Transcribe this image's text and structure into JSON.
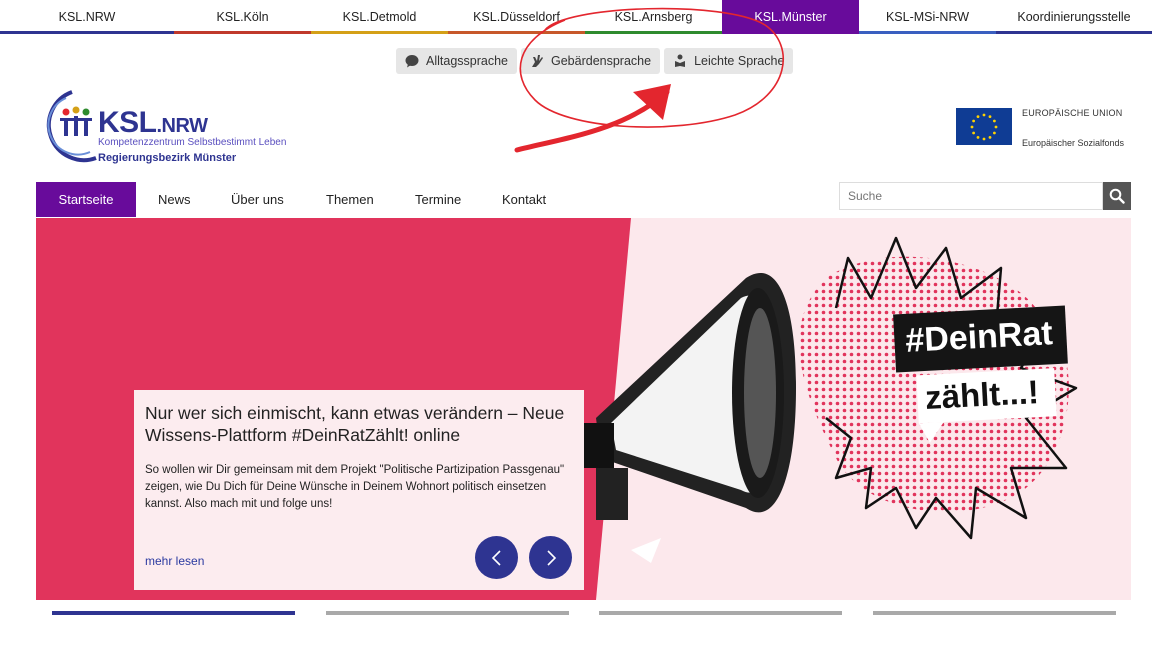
{
  "topnav": [
    {
      "label": "KSL.NRW",
      "color": "#2e3491"
    },
    {
      "label": "KSL.Köln",
      "color": "#c0392b"
    },
    {
      "label": "KSL.Detmold",
      "color": "#d4a017"
    },
    {
      "label": "KSL.Düsseldorf",
      "color": "#c7582a"
    },
    {
      "label": "KSL.Arnsberg",
      "color": "#2e8b2e"
    },
    {
      "label": "KSL.Münster",
      "color": "#680b9b",
      "active": true
    },
    {
      "label": "KSL-MSi-NRW",
      "color": "#3a5fc0"
    },
    {
      "label": "Koordinierungsstelle",
      "color": "#2e3491"
    }
  ],
  "lang_buttons": [
    {
      "label": "Alltagssprache",
      "icon": "speech-bubble-icon"
    },
    {
      "label": "Gebärdensprache",
      "icon": "sign-language-hand-icon"
    },
    {
      "label": "Leichte Sprache",
      "icon": "reading-person-icon"
    }
  ],
  "logo": {
    "name": "KSL",
    "suffix": ".NRW",
    "line1": "Kompetenzzentrum Selbstbestimmt Leben",
    "line2": "Regierungsbezirk Münster"
  },
  "eu": {
    "line1": "EUROPÄISCHE UNION",
    "line2": "Europäischer Sozialfonds"
  },
  "mainnav": [
    {
      "label": "Startseite",
      "active": true
    },
    {
      "label": "News"
    },
    {
      "label": "Über uns"
    },
    {
      "label": "Themen"
    },
    {
      "label": "Termine"
    },
    {
      "label": "Kontakt"
    }
  ],
  "search": {
    "placeholder": "Suche"
  },
  "hero": {
    "badge_line1": "#DeinRat",
    "badge_line2": "zählt...!",
    "title": "Nur wer sich einmischt, kann etwas verändern – Neue Wissens-Plattform #DeinRatZählt! online",
    "text": "So wollen wir Dir gemeinsam mit dem Projekt \"Politische Partizipation Passgenau\" zeigen, wie Du Dich für Deine Wünsche in Deinem Wohnort politisch einsetzen kannst. Also mach mit und folge uns!",
    "more": "mehr lesen"
  },
  "slider": {
    "total": 4,
    "active": 1
  },
  "colors": {
    "accent": "#680b9b",
    "hero_red": "#e1345c",
    "nav_blue": "#2e3491"
  }
}
